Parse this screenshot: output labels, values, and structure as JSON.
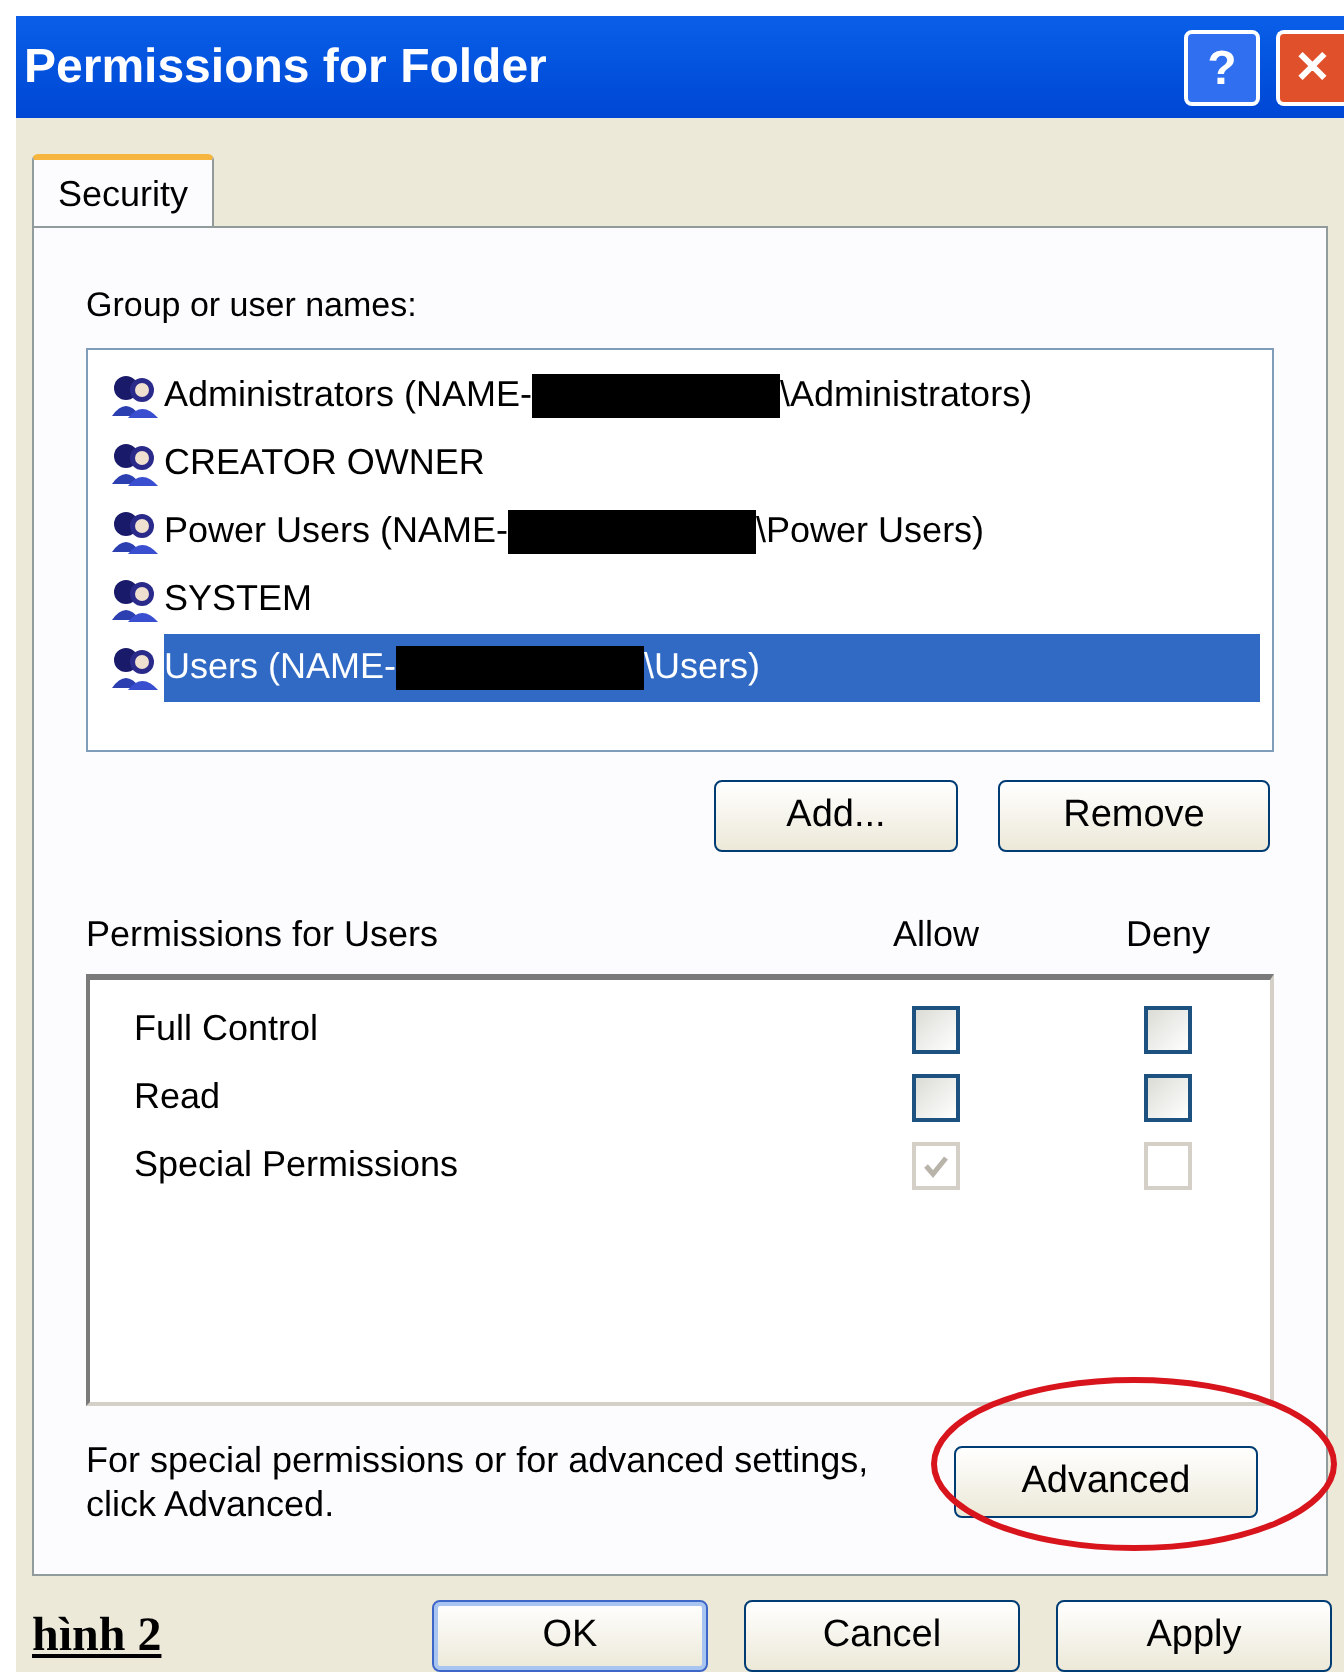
{
  "window": {
    "title": "Permissions for Folder",
    "help_button": "?",
    "close_button": "✕"
  },
  "tabs": [
    {
      "label": "Security",
      "selected": true
    }
  ],
  "group_label": "Group or user names:",
  "users": [
    {
      "prefix": "Administrators (NAME-",
      "redacted": true,
      "suffix": "\\Administrators)",
      "selected": false
    },
    {
      "prefix": "CREATOR OWNER",
      "redacted": false,
      "selected": false
    },
    {
      "prefix": "Power Users (NAME-",
      "redacted": true,
      "suffix": "\\Power Users)",
      "selected": false
    },
    {
      "prefix": "SYSTEM",
      "redacted": false,
      "selected": false
    },
    {
      "prefix": "Users (NAME-",
      "redacted": true,
      "suffix": "\\Users)",
      "selected": true
    }
  ],
  "list_buttons": [
    "Add...",
    "Remove"
  ],
  "permissions": {
    "title": "Permissions for Users",
    "allow_header": "Allow",
    "deny_header": "Deny",
    "rows": [
      {
        "name": "Full Control",
        "allow": false,
        "allow_disabled": false,
        "deny": false,
        "deny_disabled": false
      },
      {
        "name": "Read",
        "allow": false,
        "allow_disabled": false,
        "deny": false,
        "deny_disabled": false
      },
      {
        "name": "Special Permissions",
        "allow": true,
        "allow_disabled": true,
        "deny": false,
        "deny_disabled": true
      }
    ]
  },
  "advanced_note": "For special permissions or for advanced settings, click Advanced.",
  "advanced_button": "Advanced",
  "caption": "hình 2",
  "dialog_buttons": [
    {
      "label": "OK",
      "default": true
    },
    {
      "label": "Cancel",
      "default": false
    },
    {
      "label": "Apply",
      "default": false
    }
  ]
}
